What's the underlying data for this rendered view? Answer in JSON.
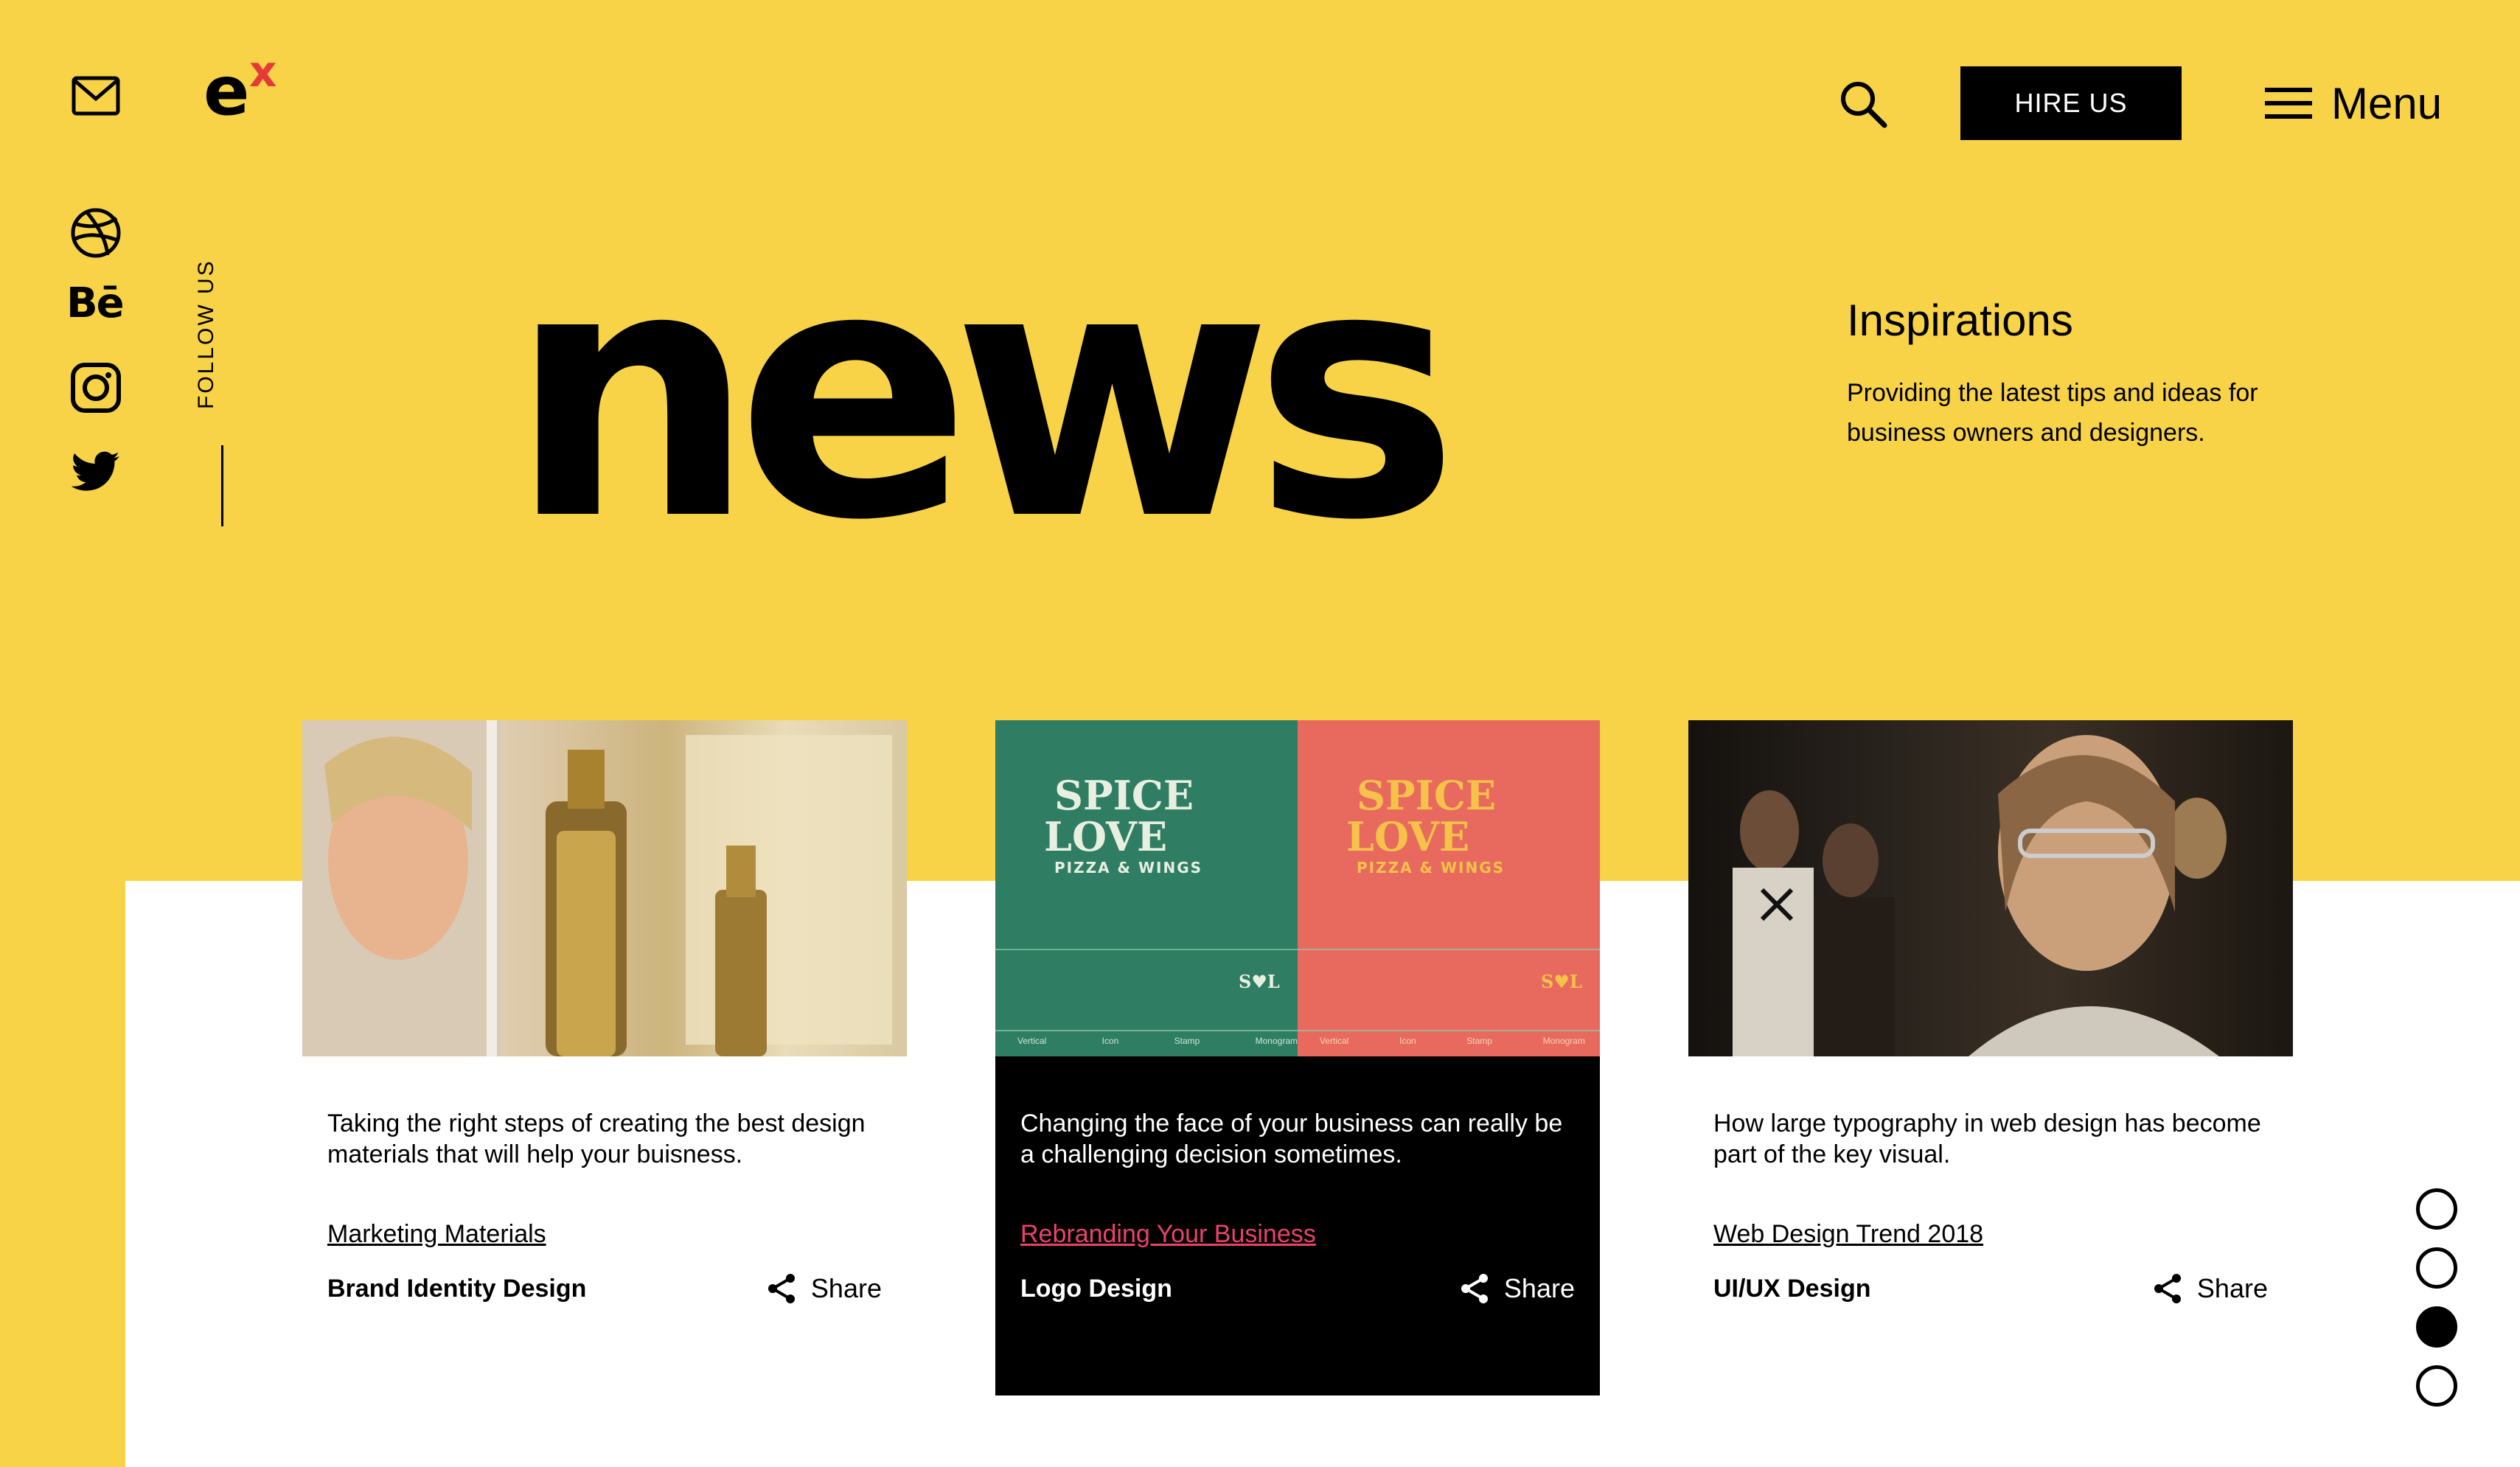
{
  "brand": {
    "logo_main": "e",
    "logo_sup": "x",
    "accent": "#e53a3a",
    "background": "#f8d347"
  },
  "header": {
    "hire_label": "HIRE US",
    "menu_label": "Menu"
  },
  "social": {
    "follow_label": "FOLLOW US",
    "behance_label": "Bē",
    "icons": [
      "mail-icon",
      "dribbble-icon",
      "behance-icon",
      "instagram-icon",
      "twitter-icon"
    ]
  },
  "hero": {
    "title": "news"
  },
  "inspirations": {
    "title": "Inspirations",
    "text": "Providing the latest tips and ideas for business owners and designers."
  },
  "cards": [
    {
      "description": "Taking the right steps of creating the best design materials that will help your buisness.",
      "tag": "Marketing Materials",
      "category": "Brand Identity Design",
      "share_label": "Share"
    },
    {
      "description": "Changing the face of your business can really be a challenging decision sometimes.",
      "tag": "Rebranding Your Business",
      "category": "Logo Design",
      "share_label": "Share",
      "image_text": {
        "spice": "SPICE",
        "love": "LOVE",
        "sub": "PIZZA & WINGS",
        "mono": "S♥L",
        "captions": [
          "Vertical",
          "Icon",
          "Stamp",
          "Monogram"
        ]
      }
    },
    {
      "description": "How large typography in web design has become part of the key visual.",
      "tag": "Web Design Trend 2018",
      "category": "UI/UX Design",
      "share_label": "Share"
    }
  ],
  "pagination": {
    "count": 4,
    "active": 3
  }
}
